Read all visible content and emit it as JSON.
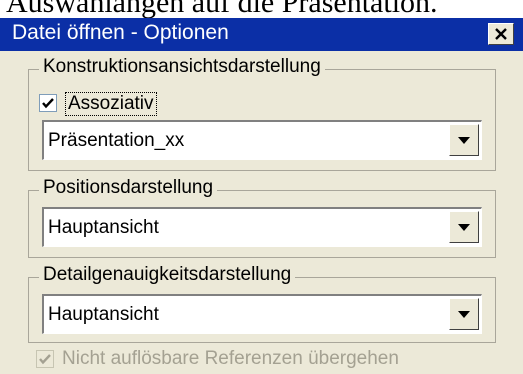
{
  "caption": "Auswahlangen auf die Präsentation.",
  "dialog": {
    "title": "Datei öffnen - Optionen",
    "close_label": "X"
  },
  "groups": [
    {
      "title": "Konstruktionsansichtsdarstellung",
      "checkbox": {
        "label": "Assoziativ",
        "checked": true
      },
      "dropdown_value": "Präsentation_xx"
    },
    {
      "title": "Positionsdarstellung",
      "dropdown_value": "Hauptansicht"
    },
    {
      "title": "Detailgenauigkeitsdarstellung",
      "dropdown_value": "Hauptansicht"
    }
  ],
  "footer_checkbox": {
    "label": "Nicht auflösbare Referenzen übergehen",
    "checked": true,
    "disabled": true
  }
}
